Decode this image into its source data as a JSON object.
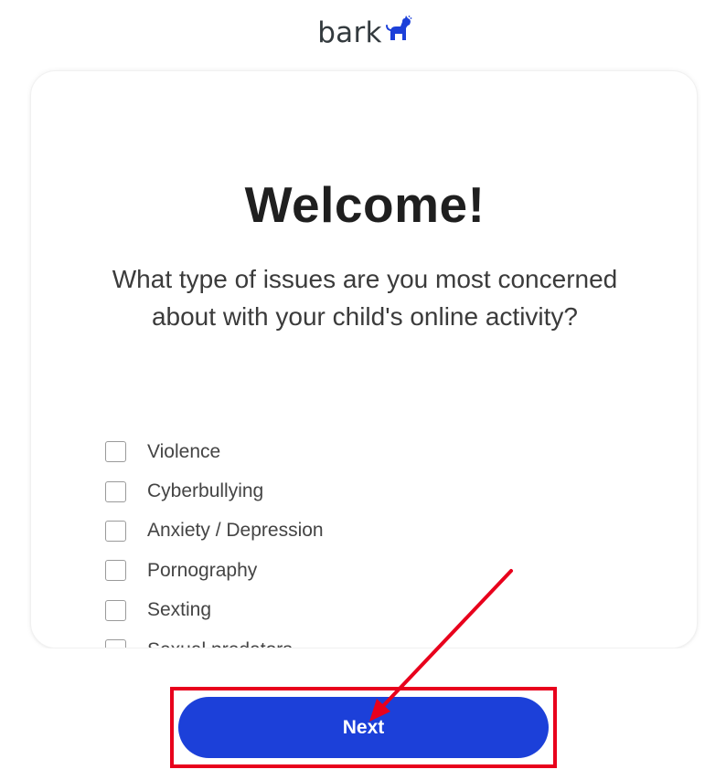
{
  "logo": {
    "text": "bark",
    "dog_icon": "dog-icon",
    "brand_color": "#1c40d9"
  },
  "card": {
    "title": "Welcome!",
    "question": "What type of issues are you most concerned about with your child's online activity?",
    "options": [
      {
        "label": "Violence",
        "checked": false
      },
      {
        "label": "Cyberbullying",
        "checked": false
      },
      {
        "label": "Anxiety / Depression",
        "checked": false
      },
      {
        "label": "Pornography",
        "checked": false
      },
      {
        "label": "Sexting",
        "checked": false
      },
      {
        "label": "Sexual predators",
        "checked": false
      }
    ]
  },
  "footer": {
    "next_label": "Next"
  },
  "annotation": {
    "highlight_color": "#e8001c"
  }
}
